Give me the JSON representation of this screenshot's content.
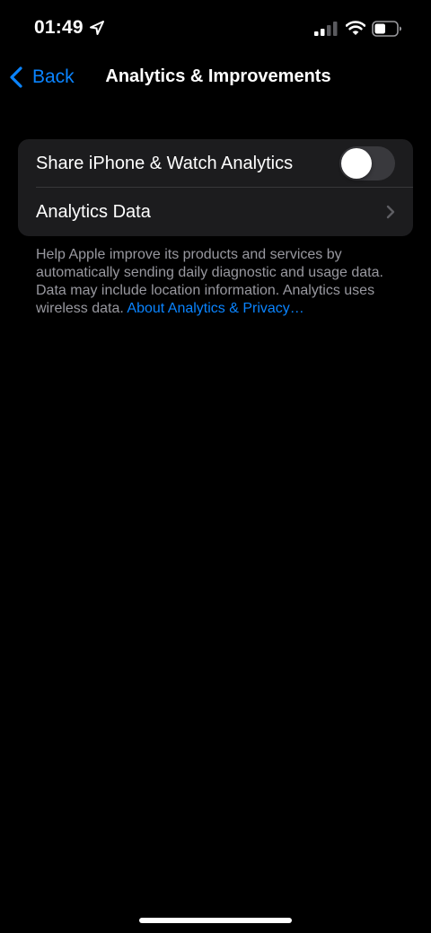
{
  "status_bar": {
    "time": "01:49",
    "icons": [
      "location-arrow-icon",
      "cellular-signal-icon",
      "wifi-icon",
      "battery-icon"
    ],
    "signal_bars_filled": 2,
    "signal_bars_total": 4,
    "battery_level": 0.5
  },
  "nav": {
    "back_label": "Back",
    "title": "Analytics & Improvements"
  },
  "settings": {
    "share_analytics": {
      "label": "Share iPhone & Watch Analytics",
      "enabled": false
    },
    "analytics_data": {
      "label": "Analytics Data"
    }
  },
  "footer": {
    "text": "Help Apple improve its products and services by automatically sending daily diagnostic and usage data. Data may include location information. Analytics uses wireless data. ",
    "link": "About Analytics & Privacy…"
  },
  "colors": {
    "background": "#000000",
    "cell": "#1c1c1e",
    "accent": "#0a84ff",
    "secondary_text": "#98989f",
    "toggle_off": "#39393d"
  }
}
